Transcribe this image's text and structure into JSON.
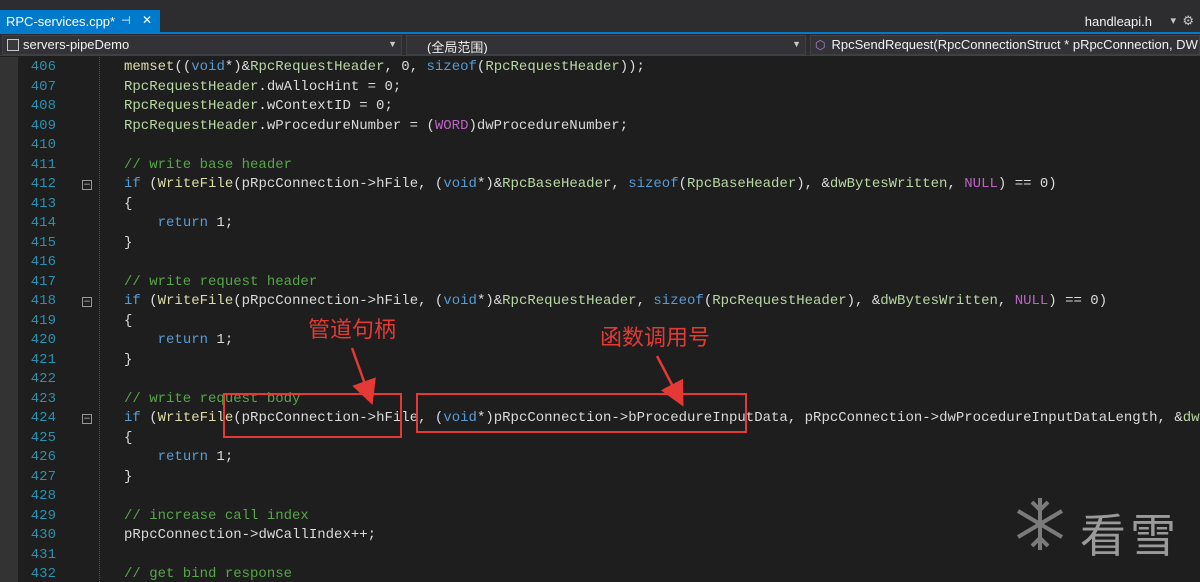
{
  "tabs": {
    "active_label": "RPC-services.cpp*",
    "pin_icon": "pin-icon",
    "close_icon": "close-icon",
    "right_label": "handleapi.h"
  },
  "nav": {
    "project": "servers-pipeDemo",
    "scope": "(全局范围)",
    "member": "RpcSendRequest(RpcConnectionStruct * pRpcConnection, DW"
  },
  "editor": {
    "lines": [
      {
        "n": "406",
        "code": "memset((void*)&RpcRequestHeader, 0, sizeof(RpcRequestHeader));"
      },
      {
        "n": "407",
        "code": "RpcRequestHeader.dwAllocHint = 0;"
      },
      {
        "n": "408",
        "code": "RpcRequestHeader.wContextID = 0;"
      },
      {
        "n": "409",
        "code": "RpcRequestHeader.wProcedureNumber = (WORD)dwProcedureNumber;"
      },
      {
        "n": "410",
        "code": ""
      },
      {
        "n": "411",
        "code": "// write base header"
      },
      {
        "n": "412",
        "code": "if (WriteFile(pRpcConnection->hFile, (void*)&RpcBaseHeader, sizeof(RpcBaseHeader), &dwBytesWritten, NULL) == 0)"
      },
      {
        "n": "413",
        "code": "{"
      },
      {
        "n": "414",
        "code": "    return 1;"
      },
      {
        "n": "415",
        "code": "}"
      },
      {
        "n": "416",
        "code": ""
      },
      {
        "n": "417",
        "code": "// write request header"
      },
      {
        "n": "418",
        "code": "if (WriteFile(pRpcConnection->hFile, (void*)&RpcRequestHeader, sizeof(RpcRequestHeader), &dwBytesWritten, NULL) == 0)"
      },
      {
        "n": "419",
        "code": "{"
      },
      {
        "n": "420",
        "code": "    return 1;"
      },
      {
        "n": "421",
        "code": "}"
      },
      {
        "n": "422",
        "code": ""
      },
      {
        "n": "423",
        "code": "// write request body"
      },
      {
        "n": "424",
        "code": "if (WriteFile(pRpcConnection->hFile, (void*)pRpcConnection->bProcedureInputData, pRpcConnection->dwProcedureInputDataLength, &dwBytesWritte"
      },
      {
        "n": "425",
        "code": "{"
      },
      {
        "n": "426",
        "code": "    return 1;"
      },
      {
        "n": "427",
        "code": "}"
      },
      {
        "n": "428",
        "code": ""
      },
      {
        "n": "429",
        "code": "// increase call index"
      },
      {
        "n": "430",
        "code": "pRpcConnection->dwCallIndex++;"
      },
      {
        "n": "431",
        "code": ""
      },
      {
        "n": "432",
        "code": "// get bind response"
      }
    ],
    "folded_lines": [
      "412",
      "418",
      "424"
    ]
  },
  "annotations": {
    "pipe_handle": "管道句柄",
    "function_number": "函数调用号"
  },
  "watermark": {
    "text": "看雪",
    "icon": "snowflake-icon"
  },
  "colors": {
    "accent": "#007acc",
    "annotation": "#e53935",
    "keyword": "#569cd6",
    "comment": "#57a64a"
  }
}
